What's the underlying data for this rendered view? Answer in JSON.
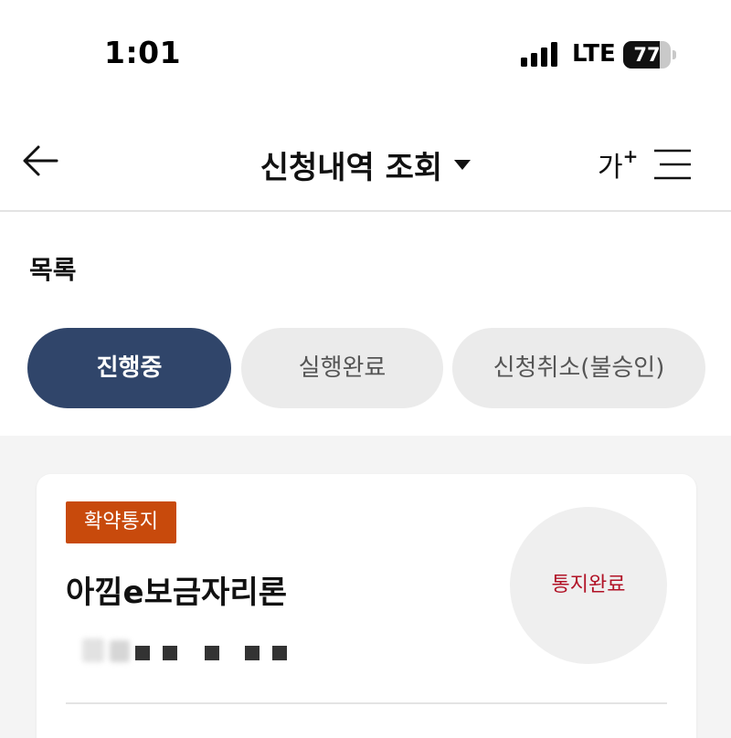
{
  "status_bar": {
    "time": "1:01",
    "network": "LTE",
    "battery_percent": 77,
    "battery_label": "77",
    "signal_bars": 4
  },
  "header": {
    "back_icon": "arrow-left-icon",
    "title": "신청내역 조회",
    "title_caret_icon": "caret-down-icon",
    "font_size_label": "가",
    "font_size_plus": "+",
    "menu_icon": "hamburger-menu-icon"
  },
  "section": {
    "title": "목록"
  },
  "tabs": [
    {
      "label": "진행중",
      "active": true
    },
    {
      "label": "실행완료",
      "active": false
    },
    {
      "label": "신청취소(불승인)",
      "active": false
    }
  ],
  "cards": [
    {
      "badge": "확약통지",
      "title": "아낌e보금자리론",
      "status": "통지완료",
      "masked_detail": "obscured"
    }
  ],
  "colors": {
    "tab_active_bg": "#30456a",
    "tab_inactive_bg": "#ebebeb",
    "badge_bg": "#c84a0c",
    "status_text": "#b11226",
    "list_bg": "#f4f4f4"
  }
}
